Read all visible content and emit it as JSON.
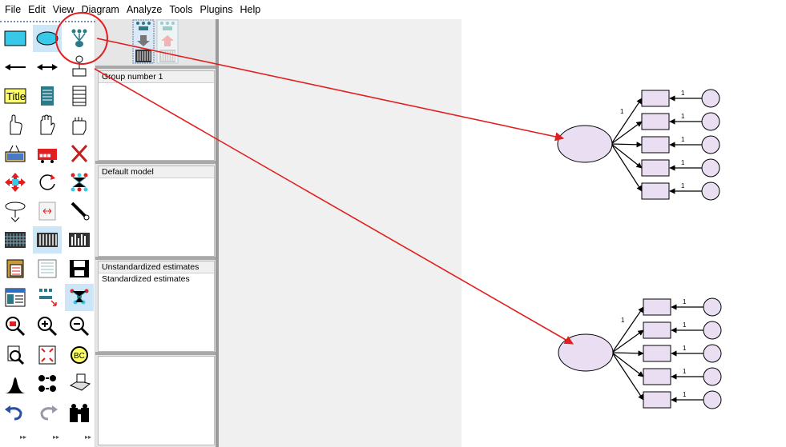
{
  "menu": [
    "File",
    "Edit",
    "View",
    "Diagram",
    "Analyze",
    "Tools",
    "Plugins",
    "Help"
  ],
  "toolbox": {
    "icons": [
      "draw-observed-variable-icon",
      "draw-unobserved-variable-icon",
      "draw-latent-indicator-icon",
      "draw-path-icon",
      "draw-covariance-icon",
      "draw-unique-variable-icon",
      "figure-caption-icon",
      "list-variables-in-model-icon",
      "list-variables-in-dataset-icon",
      "select-one-object-icon",
      "select-all-objects-icon",
      "deselect-all-objects-icon",
      "duplicate-objects-icon",
      "move-objects-icon",
      "erase-objects-icon",
      "change-shape-icon",
      "rotate-indicators-icon",
      "reflect-indicators-icon",
      "move-parameter-icon",
      "scroll-icon",
      "touch-up-icon",
      "select-data-files-icon",
      "analysis-properties-icon",
      "calculate-estimates-icon",
      "copy-to-clipboard-icon",
      "view-text-icon",
      "save-diagram-icon",
      "object-properties-icon",
      "drag-properties-icon",
      "preserve-symmetries-icon",
      "zoom-select-icon",
      "zoom-in-icon",
      "zoom-out-icon",
      "show-page-icon",
      "resize-to-page-icon",
      "magnify-icon",
      "degrees-of-freedom-icon",
      "multiple-group-icon",
      "print-icon",
      "undo-icon",
      "redo-icon",
      "specification-search-icon"
    ],
    "selected": [
      "draw-unobserved-variable-icon",
      "analysis-properties-icon",
      "preserve-symmetries-icon"
    ]
  },
  "panels": {
    "groups": [
      "Group number 1"
    ],
    "models": [
      "Default model"
    ],
    "estimates": [
      "Unstandardized estimates",
      "Standardized estimates"
    ]
  },
  "diagram": {
    "path_label": "1",
    "factors": [
      {
        "name": "latent-variable-1",
        "indicator_count": 5
      },
      {
        "name": "latent-variable-2",
        "indicator_count": 5
      }
    ]
  },
  "annotation": {
    "color": "#e02020",
    "highlighted_tool": "draw-latent-indicator-icon"
  },
  "colors": {
    "shape_fill": "#eadff2",
    "selection": "#cde6f7"
  }
}
